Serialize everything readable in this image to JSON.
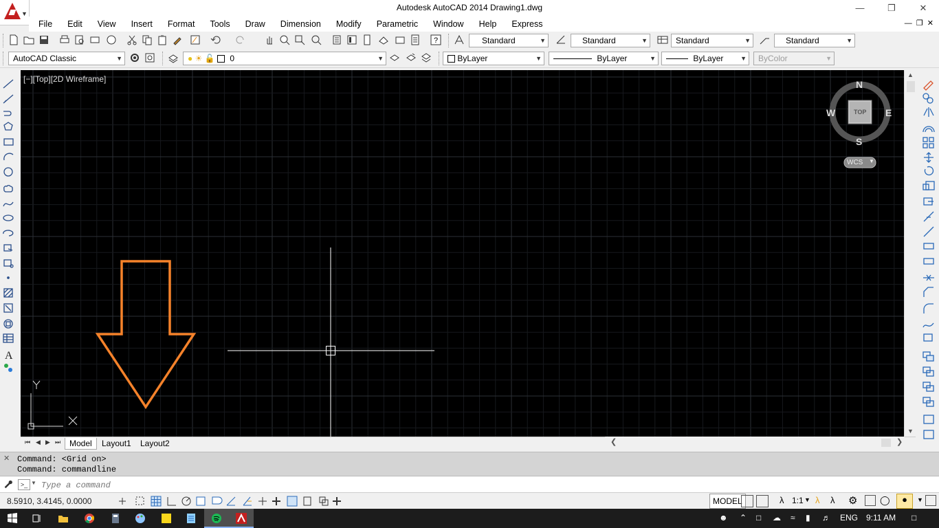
{
  "window": {
    "title": "Autodesk AutoCAD 2014    Drawing1.dwg",
    "minimize_icon": "minimize-icon",
    "restore_icon": "restore-icon",
    "close_icon": "close-icon"
  },
  "menu": {
    "items": [
      "File",
      "Edit",
      "View",
      "Insert",
      "Format",
      "Tools",
      "Draw",
      "Dimension",
      "Modify",
      "Parametric",
      "Window",
      "Help",
      "Express"
    ]
  },
  "toolbar1": {
    "text_style": "Standard",
    "dim_style": "Standard",
    "table_style": "Standard",
    "mleader_style": "Standard"
  },
  "toolbar2": {
    "workspace": "AutoCAD Classic",
    "layer": "0",
    "color": "ByLayer",
    "linetype": "ByLayer",
    "lineweight": "ByLayer",
    "plotstyle": "ByColor"
  },
  "viewport": {
    "label": "[−][Top][2D Wireframe]",
    "viewcube": {
      "north": "N",
      "south": "S",
      "east": "E",
      "west": "W",
      "face": "TOP",
      "ucs": "WCS"
    },
    "ucs_x": "X",
    "ucs_y": "Y"
  },
  "tabs": [
    "Model",
    "Layout1",
    "Layout2"
  ],
  "command": {
    "history": [
      "Command:  <Grid on>",
      "Command: commandline"
    ],
    "placeholder": "Type a command"
  },
  "status": {
    "coordinates": "8.5910, 3.4145, 0.0000",
    "space": "MODEL",
    "scale": "1:1"
  },
  "taskbar": {
    "language": "ENG",
    "time": "9:11 AM"
  },
  "colors": {
    "accent": "#c3201f",
    "annotation_arrow": "#f5822a",
    "canvas": "#000000"
  }
}
